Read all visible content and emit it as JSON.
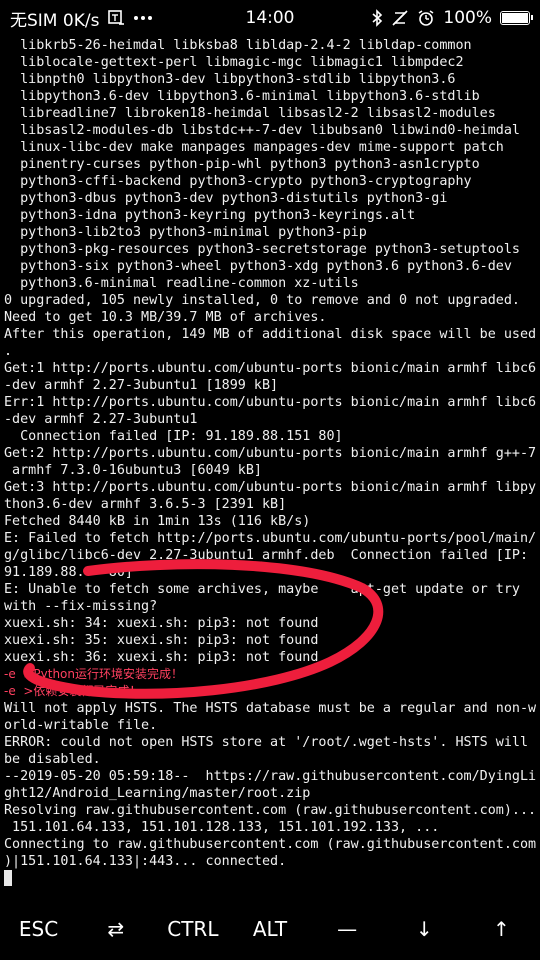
{
  "status_bar": {
    "carrier": "无SIM 0K/s",
    "time": "14:00",
    "battery_percent": "100%",
    "icons": [
      "screenshot-icon",
      "more-icon",
      "bluetooth-icon",
      "vibrate-icon",
      "alarm-icon",
      "battery-icon"
    ]
  },
  "terminal": {
    "lines": [
      "  libkrb5-26-heimdal libksba8 libldap-2.4-2 libldap-common",
      "  liblocale-gettext-perl libmagic-mgc libmagic1 libmpdec2",
      "  libnpth0 libpython3-dev libpython3-stdlib libpython3.6",
      "  libpython3.6-dev libpython3.6-minimal libpython3.6-stdlib",
      "  libreadline7 libroken18-heimdal libsasl2-2 libsasl2-modules",
      "  libsasl2-modules-db libstdc++-7-dev libubsan0 libwind0-heimdal",
      "  linux-libc-dev make manpages manpages-dev mime-support patch",
      "  pinentry-curses python-pip-whl python3 python3-asn1crypto",
      "  python3-cffi-backend python3-crypto python3-cryptography",
      "  python3-dbus python3-dev python3-distutils python3-gi",
      "  python3-idna python3-keyring python3-keyrings.alt",
      "  python3-lib2to3 python3-minimal python3-pip",
      "  python3-pkg-resources python3-secretstorage python3-setuptools",
      "  python3-six python3-wheel python3-xdg python3.6 python3.6-dev",
      "  python3.6-minimal readline-common xz-utils",
      "0 upgraded, 105 newly installed, 0 to remove and 0 not upgraded.",
      "Need to get 10.3 MB/39.7 MB of archives.",
      "After this operation, 149 MB of additional disk space will be used",
      ".",
      "Get:1 http://ports.ubuntu.com/ubuntu-ports bionic/main armhf libc6",
      "-dev armhf 2.27-3ubuntu1 [1899 kB]",
      "Err:1 http://ports.ubuntu.com/ubuntu-ports bionic/main armhf libc6",
      "-dev armhf 2.27-3ubuntu1",
      "  Connection failed [IP: 91.189.88.151 80]",
      "Get:2 http://ports.ubuntu.com/ubuntu-ports bionic/main armhf g++-7",
      " armhf 7.3.0-16ubuntu3 [6049 kB]",
      "Get:3 http://ports.ubuntu.com/ubuntu-ports bionic/main armhf libpy",
      "thon3.6-dev armhf 3.6.5-3 [2391 kB]",
      "Fetched 8440 kB in 1min 13s (116 kB/s)",
      "E: Failed to fetch http://ports.ubuntu.com/ubuntu-ports/pool/main/",
      "g/glibc/libc6-dev_2.27-3ubuntu1_armhf.deb  Connection failed [IP:",
      "91.189.88.   80]",
      "E: Unable to fetch some archives, maybe    apt-get update or try",
      "with --fix-missing?",
      "xuexi.sh: 34: xuexi.sh: pip3: not found",
      "xuexi.sh: 35: xuexi.sh: pip3: not found",
      "xuexi.sh: 36: xuexi.sh: pip3: not found",
      "-e  >Python运行环境安装完成！",
      "-e  >依赖安装都已完成！",
      "Will not apply HSTS. The HSTS database must be a regular and non-w",
      "orld-writable file.",
      "ERROR: could not open HSTS store at '/root/.wget-hsts'. HSTS will",
      "be disabled.",
      "--2019-05-20 05:59:18--  https://raw.githubusercontent.com/DyingLi",
      "ght12/Android_Learning/master/root.zip",
      "Resolving raw.githubusercontent.com (raw.githubusercontent.com)...",
      " 151.101.64.133, 151.101.128.133, 151.101.192.133, ...",
      "Connecting to raw.githubusercontent.com (raw.githubusercontent.com",
      ")|151.101.64.133|:443... connected."
    ],
    "highlight_lines": [
      37,
      38
    ],
    "annotation_color": "#ee1e3c"
  },
  "extra_keys": [
    {
      "label": "ESC",
      "name": "esc-key"
    },
    {
      "label": "⇄",
      "name": "tab-key"
    },
    {
      "label": "CTRL",
      "name": "ctrl-key"
    },
    {
      "label": "ALT",
      "name": "alt-key"
    },
    {
      "label": "—",
      "name": "dash-key"
    },
    {
      "label": "↓",
      "name": "arrow-down-key"
    },
    {
      "label": "↑",
      "name": "arrow-up-key"
    }
  ]
}
